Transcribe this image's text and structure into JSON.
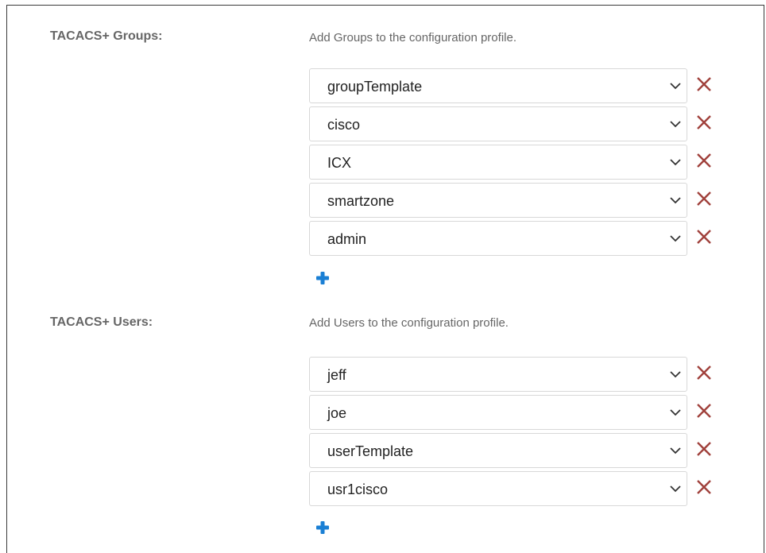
{
  "groups": {
    "label": "TACACS+ Groups:",
    "description": "Add Groups to the configuration profile.",
    "items": [
      {
        "value": "groupTemplate"
      },
      {
        "value": "cisco"
      },
      {
        "value": "ICX"
      },
      {
        "value": "smartzone"
      },
      {
        "value": "admin"
      }
    ]
  },
  "users": {
    "label": "TACACS+ Users:",
    "description": "Add Users to the configuration profile.",
    "items": [
      {
        "value": "jeff"
      },
      {
        "value": "joe"
      },
      {
        "value": "userTemplate"
      },
      {
        "value": "usr1cisco"
      }
    ]
  },
  "icons": {
    "dropdown": "chevron-down-icon",
    "remove": "close-icon",
    "add": "plus-icon"
  },
  "colors": {
    "remove_icon": "#a0413c",
    "add_icon": "#1a7fd4",
    "label_text": "#666666",
    "value_text": "#222222",
    "field_border": "#d8d8d8"
  }
}
